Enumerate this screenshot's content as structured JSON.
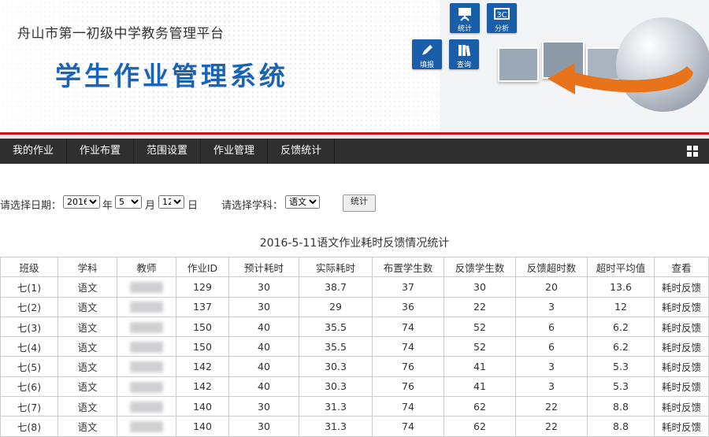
{
  "header": {
    "school_name": "舟山市第一初级中学教务管理平台",
    "system_name": "学生作业管理系统",
    "quick_buttons": [
      {
        "label": "统计",
        "icon": "presentation-icon"
      },
      {
        "label": "分析",
        "icon": "analysis-icon"
      },
      {
        "label": "填报",
        "icon": "pencil-icon"
      },
      {
        "label": "查询",
        "icon": "books-icon"
      }
    ]
  },
  "nav": {
    "items": [
      "我的作业",
      "作业布置",
      "范围设置",
      "作业管理",
      "反馈统计"
    ],
    "menu_icon": "grid-icon"
  },
  "filters": {
    "date_label": "请选择日期：",
    "year": "2016",
    "year_unit": "年",
    "month": "5",
    "month_unit": "月",
    "day": "12",
    "day_unit": "日",
    "subject_label": "请选择学科：",
    "subject": "语文",
    "submit_label": "统计"
  },
  "report": {
    "title": "2016-5-11语文作业耗时反馈情况统计",
    "columns": [
      "班级",
      "学科",
      "教师",
      "作业ID",
      "预计耗时",
      "实际耗时",
      "布置学生数",
      "反馈学生数",
      "反馈超时数",
      "超时平均值",
      "查看"
    ],
    "rows": [
      {
        "class": "七(1)",
        "subject": "语文",
        "id": "129",
        "est": "30",
        "actual": "38.7",
        "assigned": "37",
        "feedback": "30",
        "overtime": "20",
        "avg": "13.6",
        "link": "耗时反馈"
      },
      {
        "class": "七(2)",
        "subject": "语文",
        "id": "137",
        "est": "30",
        "actual": "29",
        "assigned": "36",
        "feedback": "22",
        "overtime": "3",
        "avg": "12",
        "link": "耗时反馈"
      },
      {
        "class": "七(3)",
        "subject": "语文",
        "id": "150",
        "est": "40",
        "actual": "35.5",
        "assigned": "74",
        "feedback": "52",
        "overtime": "6",
        "avg": "6.2",
        "link": "耗时反馈"
      },
      {
        "class": "七(4)",
        "subject": "语文",
        "id": "150",
        "est": "40",
        "actual": "35.5",
        "assigned": "74",
        "feedback": "52",
        "overtime": "6",
        "avg": "6.2",
        "link": "耗时反馈"
      },
      {
        "class": "七(5)",
        "subject": "语文",
        "id": "142",
        "est": "40",
        "actual": "30.3",
        "assigned": "76",
        "feedback": "41",
        "overtime": "3",
        "avg": "5.3",
        "link": "耗时反馈"
      },
      {
        "class": "七(6)",
        "subject": "语文",
        "id": "142",
        "est": "40",
        "actual": "30.3",
        "assigned": "76",
        "feedback": "41",
        "overtime": "3",
        "avg": "5.3",
        "link": "耗时反馈"
      },
      {
        "class": "七(7)",
        "subject": "语文",
        "id": "140",
        "est": "30",
        "actual": "31.3",
        "assigned": "74",
        "feedback": "62",
        "overtime": "22",
        "avg": "8.8",
        "link": "耗时反馈"
      },
      {
        "class": "七(8)",
        "subject": "语文",
        "id": "140",
        "est": "30",
        "actual": "31.3",
        "assigned": "74",
        "feedback": "62",
        "overtime": "22",
        "avg": "8.8",
        "link": "耗时反馈"
      }
    ]
  },
  "colors": {
    "brand_blue": "#1b63b3",
    "nav_bg": "#2f2f2f",
    "accent_red": "#c8141d",
    "arrow_orange": "#e8731a"
  }
}
